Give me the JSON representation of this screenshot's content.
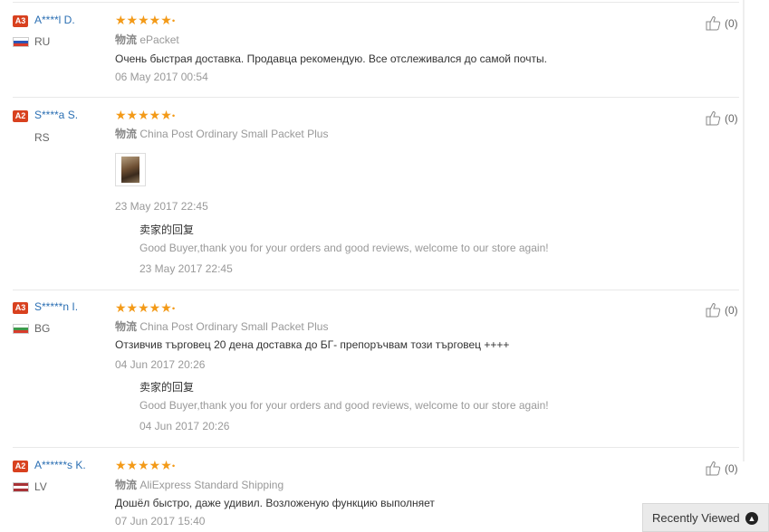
{
  "reviews": [
    {
      "badge": "A3",
      "name": "A****l D.",
      "country": "RU",
      "flag_colors": [
        "#ffffff",
        "#2a56b8",
        "#d83b2b"
      ],
      "stars": "★★★★★",
      "logistics_label": "物流",
      "logistics": "ePacket",
      "text": "Очень быстрая доставка. Продавца рекомендую. Все отслеживался до самой почты.",
      "date": "06 May 2017 00:54",
      "likes": "(0)"
    },
    {
      "badge": "A2",
      "name": "S****a S.",
      "country": "RS",
      "stars": "★★★★★",
      "logistics_label": "物流",
      "logistics": "China Post Ordinary Small Packet Plus",
      "date": "23 May 2017 22:45",
      "reply_title": "卖家的回复",
      "reply_text": "Good Buyer,thank you for your orders and good reviews, welcome to our store again!",
      "reply_date": "23 May 2017 22:45",
      "likes": "(0)"
    },
    {
      "badge": "A3",
      "name": "S*****n I.",
      "country": "BG",
      "flag_colors": [
        "#ffffff",
        "#3d9a4a",
        "#d83b2b"
      ],
      "stars": "★★★★★",
      "logistics_label": "物流",
      "logistics": "China Post Ordinary Small Packet Plus",
      "text": "Отзивчив търговец 20 дена доставка до БГ- препоръчвам този търговец ++++",
      "date": "04 Jun 2017 20:26",
      "reply_title": "卖家的回复",
      "reply_text": "Good Buyer,thank you for your orders and good reviews, welcome to our store again!",
      "reply_date": "04 Jun 2017 20:26",
      "likes": "(0)"
    },
    {
      "badge": "A2",
      "name": "A******s K.",
      "country": "LV",
      "flag_colors": [
        "#a83236",
        "#ffffff",
        "#a83236"
      ],
      "stars": "★★★★★",
      "logistics_label": "物流",
      "logistics": "AliExpress Standard Shipping",
      "text": "Дошёл быстро, даже удивил. Возложеную функцию выполняет",
      "date": "07 Jun 2017 15:40",
      "likes": "(0)"
    }
  ],
  "recently_viewed": {
    "label": "Recently Viewed",
    "icon": "chevron-up-icon"
  }
}
